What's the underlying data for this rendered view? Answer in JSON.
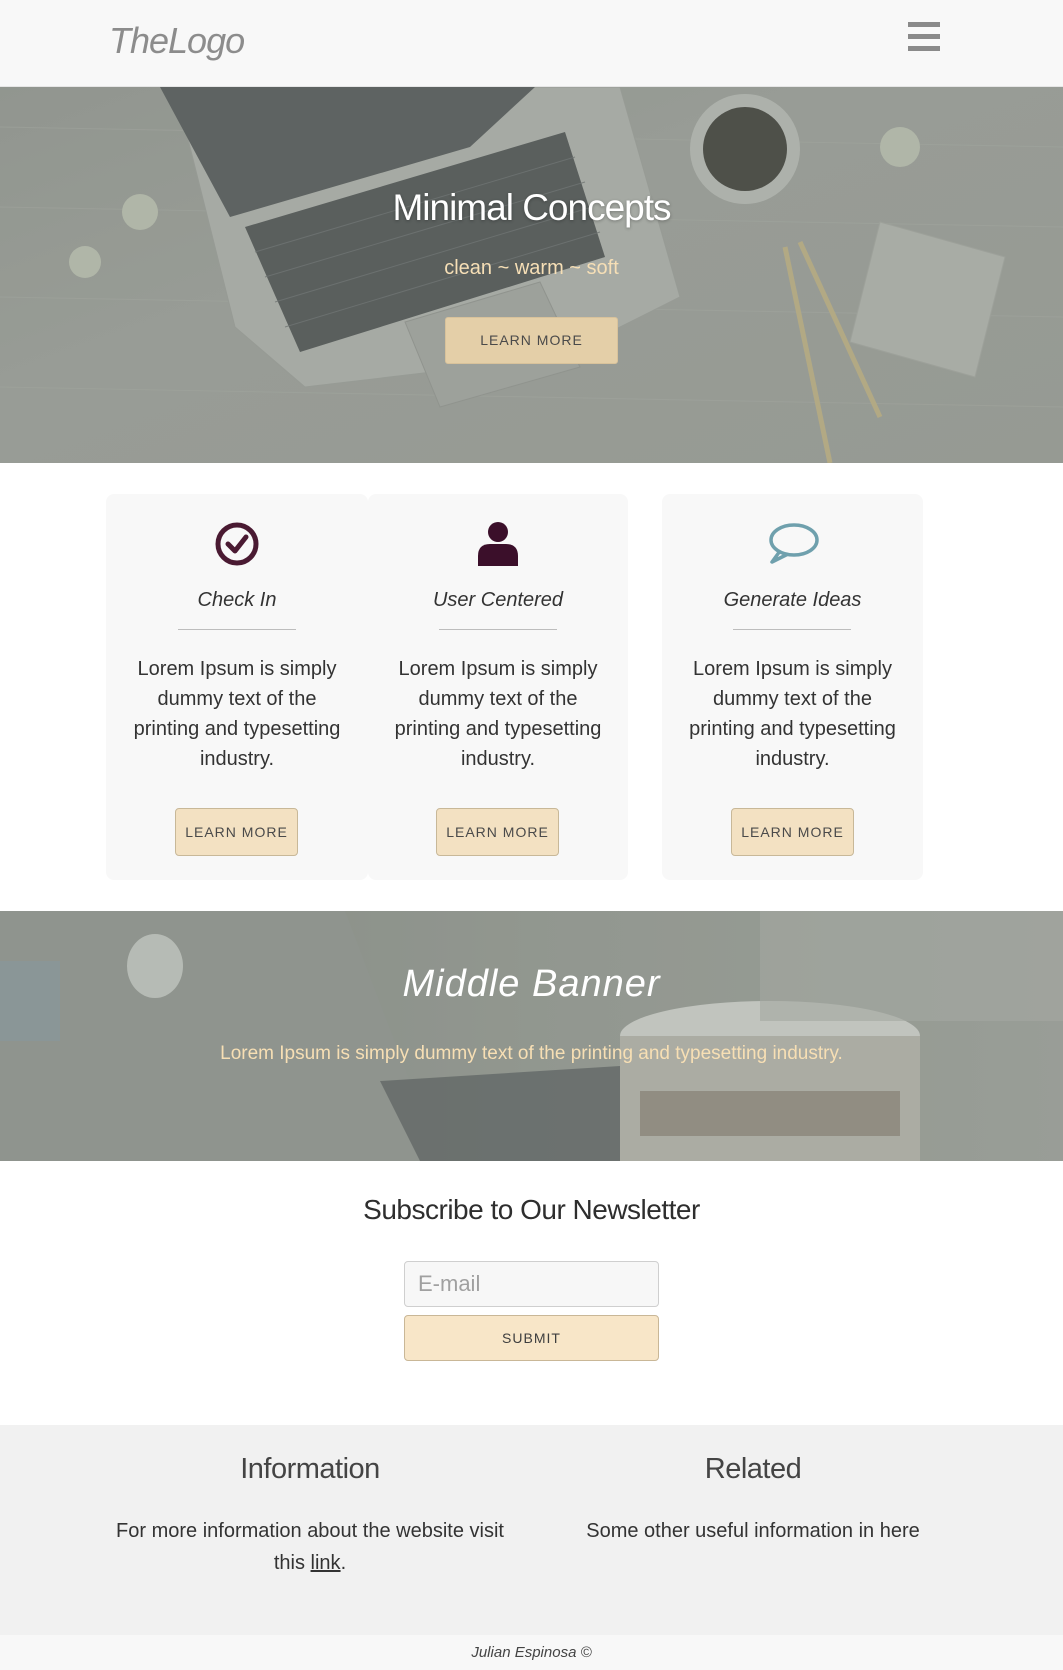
{
  "header": {
    "logo": "TheLogo",
    "menu_icon": "hamburger-menu-icon"
  },
  "hero": {
    "title": "Minimal Concepts",
    "subtitle": "clean ~ warm ~ soft",
    "button": "LEARN MORE"
  },
  "cards": [
    {
      "icon": "check-circle-icon",
      "icon_color": "#4a1a32",
      "title": "Check In",
      "text_lines": [
        "Lorem Ipsum is simply",
        "dummy text of the",
        "printing and typesetting",
        "industry."
      ],
      "button": "LEARN MORE"
    },
    {
      "icon": "user-icon",
      "icon_color": "#3b0f2a",
      "title": "User Centered",
      "text_lines": [
        "Lorem Ipsum is simply",
        "dummy text of the",
        "printing and typesetting",
        "industry."
      ],
      "button": "LEARN MORE"
    },
    {
      "icon": "speech-bubble-icon",
      "icon_color": "#6fa0ad",
      "title": "Generate Ideas",
      "text_lines": [
        "Lorem Ipsum is simply",
        "dummy text of the",
        "printing and typesetting",
        "industry."
      ],
      "button": "LEARN MORE"
    }
  ],
  "banner": {
    "title": "Middle Banner",
    "text": "Lorem Ipsum is simply dummy text of the printing and typesetting industry."
  },
  "newsletter": {
    "title": "Subscribe to Our Newsletter",
    "email_placeholder": "E-mail",
    "submit": "SUBMIT"
  },
  "footer": {
    "info_title": "Information",
    "info_text_before": "For more information about the website visit",
    "info_text_this": "this ",
    "info_link": "link",
    "info_text_after": ".",
    "related_title": "Related",
    "related_text": "Some other useful information in here",
    "copyright": "Julian Espinosa ©"
  },
  "colors": {
    "accent_button": "#e4cfa8",
    "hero_subtitle": "#f6dfb6",
    "header_bg": "#f8f8f8",
    "footer_bg": "#f1f1f1"
  }
}
